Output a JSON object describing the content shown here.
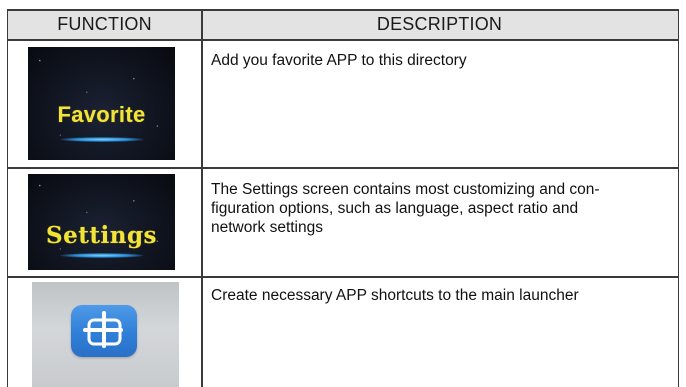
{
  "table": {
    "headers": {
      "function": "FUNCTION",
      "description": "DESCRIPTION"
    },
    "rows": [
      {
        "thumbnail_label": "Favorite",
        "icon": "favorite-thumbnail",
        "description_lines": [
          "Add you favorite APP to this directory"
        ]
      },
      {
        "thumbnail_label": "Settings",
        "icon": "settings-thumbnail",
        "description_lines": [
          "The Settings screen contains most  customizing and con-",
          "figuration options, such as language, aspect ratio and",
          "network  settings"
        ]
      },
      {
        "thumbnail_label": "",
        "icon": "add-shortcut-icon",
        "description_lines": [
          "Create necessary APP shortcuts to the main launcher"
        ]
      }
    ]
  },
  "colors": {
    "header_background": "#e3e3e3",
    "border": "#3a3a3a",
    "thumbnail_text": "#f2e33a",
    "add_icon_blue": "#2f7fd8"
  }
}
